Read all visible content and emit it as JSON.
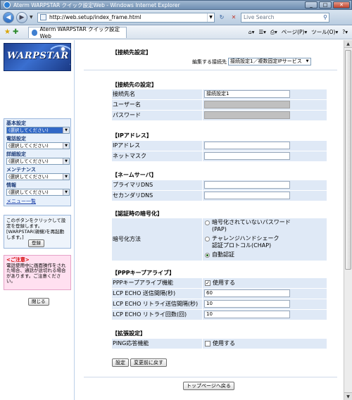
{
  "window": {
    "title": "Aterm WARPSTAR クイック設定Web - Windows Internet Explorer",
    "minimize": "_",
    "maximize": "□",
    "close": "✕"
  },
  "address": {
    "url": "http://web.setup/index_frame.html",
    "search_placeholder": "Live Search"
  },
  "command_bar": {
    "tab_title": "Aterm WARPSTAR クイック設定Web",
    "page_menu": "ページ(P)",
    "tools_menu": "ツール(O)"
  },
  "sidebar": {
    "logo_text": "WARPSTAR",
    "groups": [
      {
        "title": "基本設定",
        "selected": "(選択してください)"
      },
      {
        "title": "電話設定",
        "selected": "(選択してください)"
      },
      {
        "title": "詳細設定",
        "selected": "(選択してください)"
      },
      {
        "title": "メンテナンス",
        "selected": "(選択してください)"
      },
      {
        "title": "情報",
        "selected": "(選択してください)"
      }
    ],
    "menu_list_link": "メニュー一覧",
    "register_note": "このボタンをクリックして設定を登録します。[WARPSTAR(親機)を再起動します。]",
    "register_button": "登録",
    "caution_title": "<ご注意>",
    "caution_text": "電話使用中に画面操作をされた場合、通話が途切れる場合があります。ご注意ください。",
    "close_button": "閉じる"
  },
  "main": {
    "connection_heading": "【接続先設定】",
    "edit_label": "編集する接続先",
    "edit_selected": "接続設定1／複数固定IPサービス",
    "conn_settings_heading": "【接続先の設定】",
    "conn_rows": [
      {
        "label": "接続先名",
        "value": "接続設定1"
      },
      {
        "label": "ユーザー名",
        "value": ""
      },
      {
        "label": "パスワード",
        "value": ""
      }
    ],
    "ip_heading": "【IPアドレス】",
    "ip_rows": [
      {
        "label": "IPアドレス",
        "value": ""
      },
      {
        "label": "ネットマスク",
        "value": ""
      }
    ],
    "dns_heading": "【ネームサーバ】",
    "dns_rows": [
      {
        "label": "プライマリDNS",
        "value": ""
      },
      {
        "label": "セカンダリDNS",
        "value": ""
      }
    ],
    "auth_heading": "【認証時の暗号化】",
    "auth_label": "暗号化方法",
    "auth_options": [
      {
        "label": "暗号化されていないパスワード(PAP)",
        "line1": "暗号化されていないパスワード",
        "line2": "(PAP)",
        "selected": false
      },
      {
        "label": "チャレンジハンドシェーク認証プロトコル(CHAP)",
        "line1": "チャレンジハンドシェーク",
        "line2": "認証プロトコル(CHAP)",
        "selected": false
      },
      {
        "label": "自動認証",
        "line1": "自動認証",
        "line2": "",
        "selected": true
      }
    ],
    "ppp_heading": "【PPPキープアライブ】",
    "ppp_rows": [
      {
        "label": "PPPキープアライブ機能",
        "checkbox": "使用する",
        "checked": true
      },
      {
        "label": "LCP ECHO 送信間隔(秒)",
        "value": "60"
      },
      {
        "label": "LCP ECHO リトライ送信間隔(秒)",
        "value": "10"
      },
      {
        "label": "LCP ECHO リトライ回数(回)",
        "value": "10"
      }
    ],
    "ext_heading": "【拡張設定】",
    "ext_rows": [
      {
        "label": "PING応答機能",
        "checkbox": "使用する",
        "checked": false
      }
    ],
    "set_button": "設定",
    "revert_button": "変更前に戻す",
    "top_button": "トップページへ戻る"
  }
}
